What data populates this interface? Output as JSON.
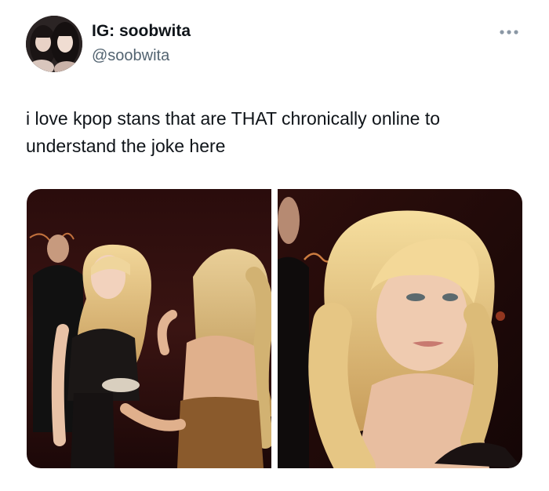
{
  "tweet": {
    "display_name": "IG: soobwita",
    "handle": "@soobwita",
    "text": "i love kpop stans that are THAT chronically online to understand the joke here",
    "more_icon": "ellipsis-icon",
    "avatar_icon": "avatar",
    "media": [
      {
        "name": "photo-left",
        "icon": "photo"
      },
      {
        "name": "photo-right",
        "icon": "photo"
      }
    ]
  },
  "colors": {
    "text": "#0f1419",
    "secondary": "#536471",
    "more_dots": "#8b98a5"
  }
}
